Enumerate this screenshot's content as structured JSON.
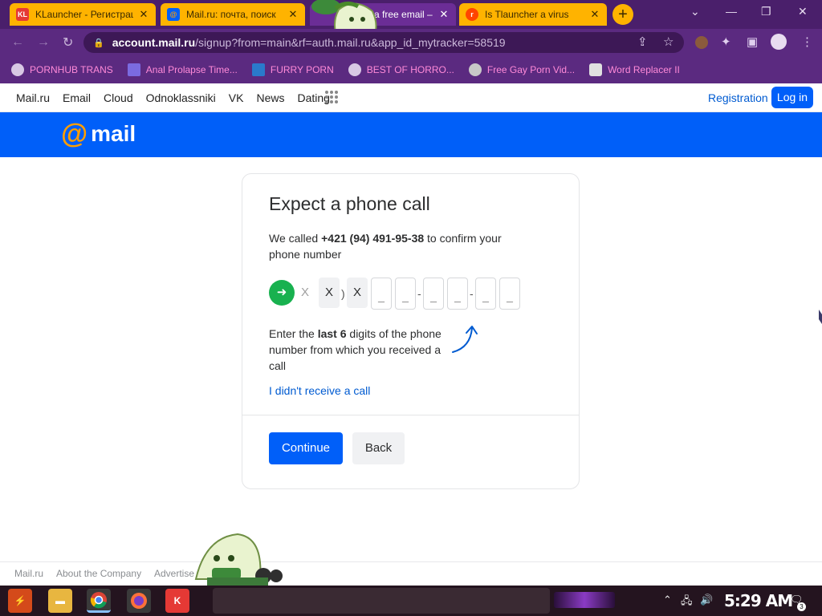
{
  "browser": {
    "tabs": [
      {
        "title": "KLauncher - Регистрация",
        "favicon": "klauncher-icon"
      },
      {
        "title": "Mail.ru: почта, поиск",
        "favicon": "mailru-icon"
      },
      {
        "title": "a free email –",
        "favicon": "mailru-icon",
        "active": true
      },
      {
        "title": "Is Tlauncher a virus",
        "favicon": "reddit-icon"
      }
    ],
    "new_tab": "+",
    "close_glyph": "✕",
    "window_controls": {
      "minimize": "—",
      "maximize": "❐",
      "close": "✕"
    },
    "url_host": "account.mail.ru",
    "url_path": "/signup?from=main&rf=auth.mail.ru&app_id_mytracker=58519"
  },
  "bookmarks": [
    {
      "label": "PORNHUB TRANS"
    },
    {
      "label": "Anal Prolapse Time..."
    },
    {
      "label": "FURRY PORN"
    },
    {
      "label": "BEST OF HORRO..."
    },
    {
      "label": "Free Gay Porn Vid..."
    },
    {
      "label": "Word Replacer II"
    }
  ],
  "portal": {
    "links": [
      "Mail.ru",
      "Email",
      "Cloud",
      "Odnoklassniki",
      "VK",
      "News",
      "Dating"
    ],
    "registration": "Registration",
    "login": "Log in",
    "logo_at": "@",
    "logo_text": "mail"
  },
  "card": {
    "title": "Expect a phone call",
    "lead_prefix": "We called ",
    "lead_phone": "+421 (94) 491-95-38",
    "lead_suffix": " to confirm your phone number",
    "mask": [
      "X",
      "X",
      ")",
      "X"
    ],
    "digit_placeholder": "_",
    "dash": "-",
    "hint_prefix": "Enter the ",
    "hint_bold": "last 6",
    "hint_suffix": " digits of the phone number from which you received a call",
    "no_call_link": "I didn't receive a call",
    "continue": "Continue",
    "back": "Back"
  },
  "footer": {
    "links": [
      "Mail.ru",
      "About the Company",
      "Advertise"
    ]
  },
  "taskbar": {
    "clock": "5:29 AM",
    "notification_count": "3"
  },
  "colors": {
    "brand_blue": "#005ff9",
    "accent_orange": "#ff9e00",
    "success_green": "#18b14f",
    "browser_purple": "#5b2a80",
    "tab_orange": "#ffb300"
  }
}
